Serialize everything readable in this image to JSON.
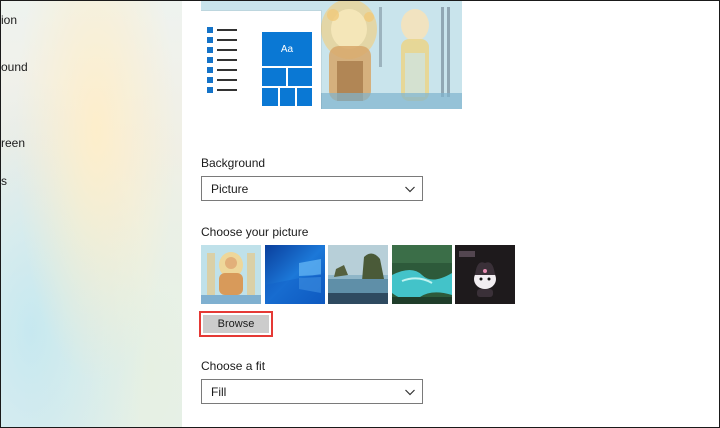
{
  "sidebar": {
    "items": [
      {
        "label": "ion"
      },
      {
        "label": "ound"
      },
      {
        "label": "reen"
      },
      {
        "label": "s"
      }
    ]
  },
  "preview": {
    "tile_text": "Aa"
  },
  "background": {
    "label": "Background",
    "selected": "Picture"
  },
  "choose_picture": {
    "label": "Choose your picture",
    "thumbnails": [
      {
        "icon": "buddhist-art-thumbnail"
      },
      {
        "icon": "windows-blue-thumbnail"
      },
      {
        "icon": "beach-rocks-thumbnail"
      },
      {
        "icon": "river-stream-thumbnail"
      },
      {
        "icon": "kuromi-dark-thumbnail"
      }
    ],
    "browse_label": "Browse"
  },
  "fit": {
    "label": "Choose a fit",
    "selected": "Fill"
  },
  "colors": {
    "accent": "#0a78d4",
    "highlight_border": "#e53935",
    "button_bg": "#cccccc"
  }
}
